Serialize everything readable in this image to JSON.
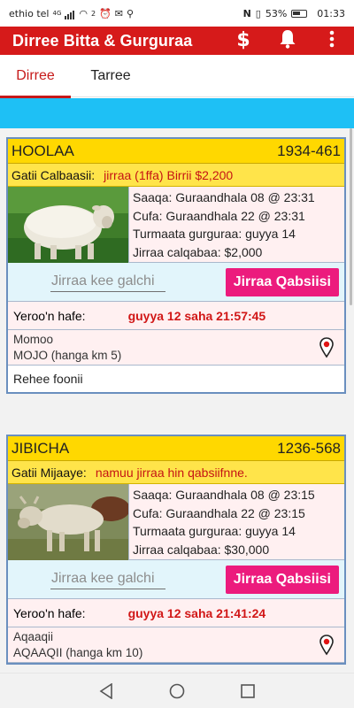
{
  "status_bar": {
    "carrier": "ethio tel",
    "network": "4G",
    "sim2": "2",
    "battery": "53%",
    "time": "01:33"
  },
  "app_bar": {
    "title": "Dirree Bitta & Gurguraa",
    "dollar_icon": "dollar-icon",
    "bell_icon": "bell-icon",
    "menu_icon": "more-vert-icon"
  },
  "tabs": [
    {
      "label": "Dirree",
      "active": true
    },
    {
      "label": "Tarree",
      "active": false
    }
  ],
  "colors": {
    "appbar": "#d61a1a",
    "tab_active": "#c61a1a",
    "banner": "#1ec0f5",
    "card_header": "#ffd800",
    "bid_button": "#ec1b7d",
    "time_value": "#d11717"
  },
  "listings": [
    {
      "name": "HOOLAA",
      "code": "1934-461",
      "price_label": "Gatii Calbaasii:",
      "price_value": "jirraa (1ffa) Birrii $2,200",
      "details": [
        "Saaqa: Guraandhala 08 @ 23:31",
        "Cufa: Guraandhala 22 @ 23:31",
        "Turmaata gurguraa: guyya 14",
        "Jirraa calqabaa: $2,000"
      ],
      "bid_placeholder": "Jirraa kee galchi",
      "bid_button": "Jirraa Qabsiisi",
      "time_left_label": "Yeroo'n hafe:",
      "time_left_value": "guyya 12 saha 21:57:45",
      "location_line1": "Momoo",
      "location_line2": "MOJO  (hanga km 5)",
      "phone_label": "Rehee foonii",
      "photo": "sheep-photo"
    },
    {
      "name": "JIBICHA",
      "code": "1236-568",
      "price_label": "Gatii Mijaaye:",
      "price_value": "namuu jirraa hin qabsiifnne.",
      "details": [
        "Saaqa: Guraandhala 08 @ 23:15",
        "Cufa: Guraandhala 22 @ 23:15",
        "Turmaata gurguraa: guyya 14",
        "Jirraa calqabaa: $30,000"
      ],
      "bid_placeholder": "Jirraa kee galchi",
      "bid_button": "Jirraa Qabsiisi",
      "time_left_label": "Yeroo'n hafe:",
      "time_left_value": "guyya 12 saha 21:41:24",
      "location_line1": "Aqaaqii",
      "location_line2": "AQAAQII  (hanga km 10)",
      "photo": "cattle-photo"
    }
  ],
  "nav_bar": [
    "back-icon",
    "home-icon",
    "recents-icon"
  ]
}
